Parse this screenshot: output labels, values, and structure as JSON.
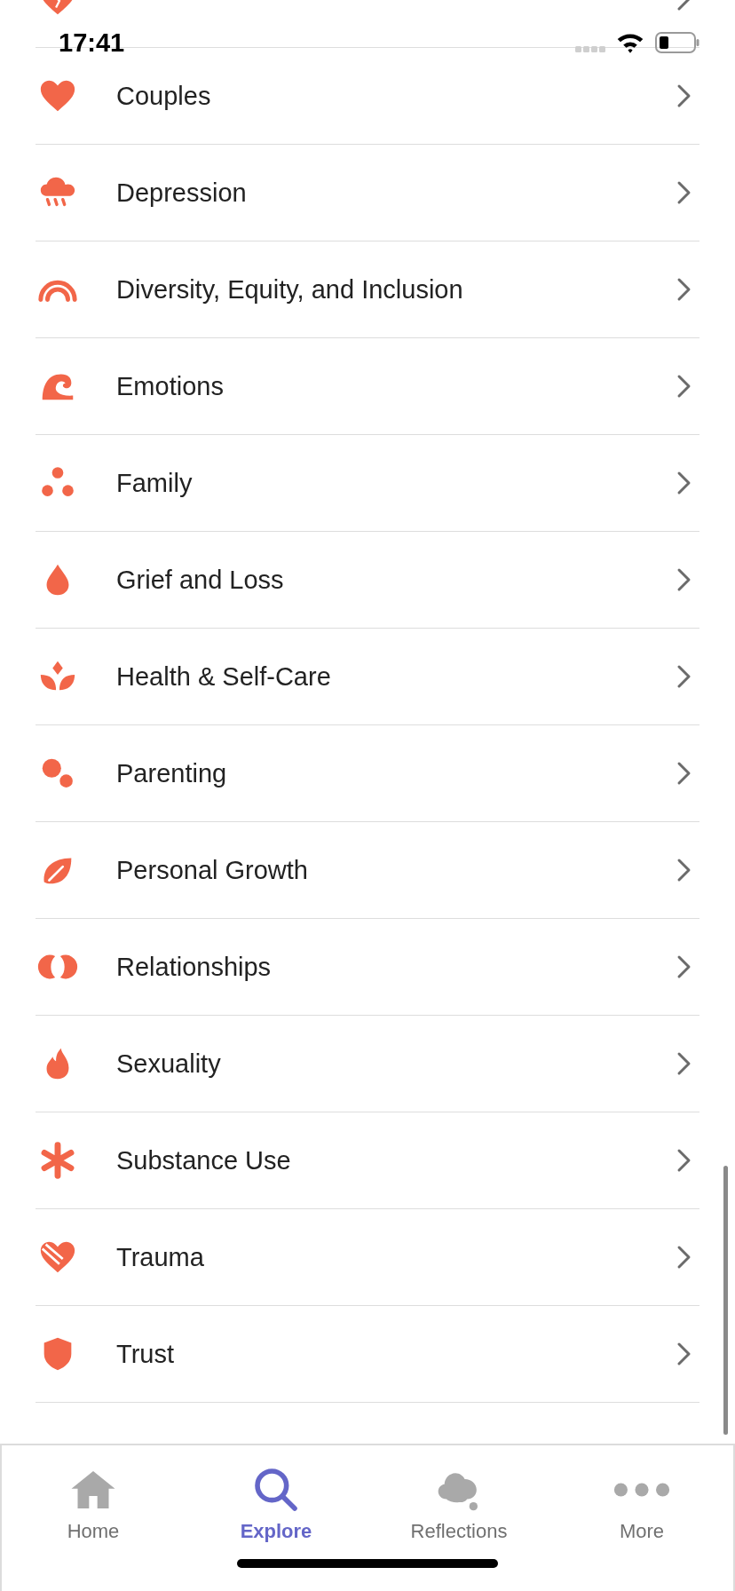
{
  "status_bar": {
    "time": "17:41"
  },
  "topics": [
    {
      "label": "Couples"
    },
    {
      "label": "Depression"
    },
    {
      "label": "Diversity, Equity, and Inclusion"
    },
    {
      "label": "Emotions"
    },
    {
      "label": "Family"
    },
    {
      "label": "Grief and Loss"
    },
    {
      "label": "Health & Self-Care"
    },
    {
      "label": "Parenting"
    },
    {
      "label": "Personal Growth"
    },
    {
      "label": "Relationships"
    },
    {
      "label": "Sexuality"
    },
    {
      "label": "Substance Use"
    },
    {
      "label": "Trauma"
    },
    {
      "label": "Trust"
    }
  ],
  "tab_bar": [
    {
      "label": "Home",
      "selected": false
    },
    {
      "label": "Explore",
      "selected": true
    },
    {
      "label": "Reflections",
      "selected": false
    },
    {
      "label": "More",
      "selected": false
    }
  ]
}
